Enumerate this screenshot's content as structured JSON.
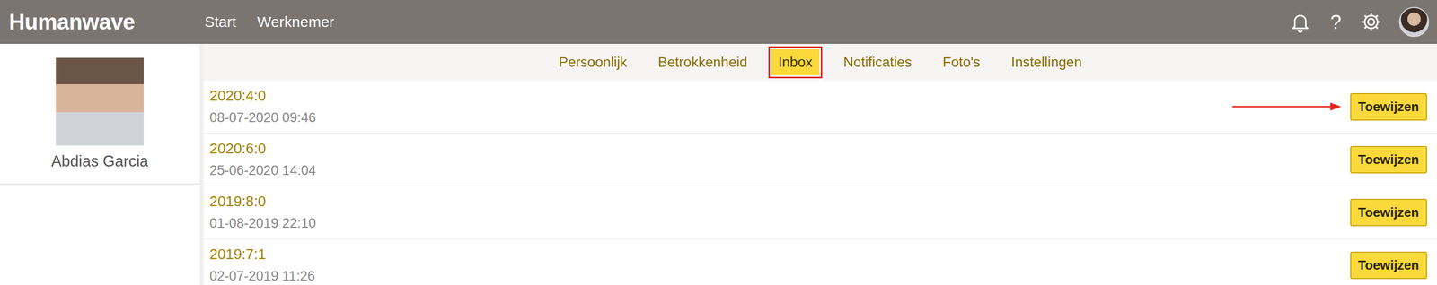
{
  "header": {
    "logo": "Humanwave",
    "nav": [
      {
        "label": "Start"
      },
      {
        "label": "Werknemer"
      }
    ],
    "help": "?"
  },
  "profile": {
    "name": "Abdias Garcia"
  },
  "tabs": [
    {
      "label": "Persoonlijk",
      "selected": false,
      "outlined": false
    },
    {
      "label": "Betrokkenheid",
      "selected": false,
      "outlined": false
    },
    {
      "label": "Inbox",
      "selected": true,
      "outlined": true
    },
    {
      "label": "Notificaties",
      "selected": false,
      "outlined": false
    },
    {
      "label": "Foto's",
      "selected": false,
      "outlined": false
    },
    {
      "label": "Instellingen",
      "selected": false,
      "outlined": false
    }
  ],
  "inbox": [
    {
      "title": "2020:4:0",
      "date": "08-07-2020 09:46",
      "button": "Toewijzen",
      "pointed": true
    },
    {
      "title": "2020:6:0",
      "date": "25-06-2020 14:04",
      "button": "Toewijzen",
      "pointed": false
    },
    {
      "title": "2019:8:0",
      "date": "01-08-2019 22:10",
      "button": "Toewijzen",
      "pointed": false
    },
    {
      "title": "2019:7:1",
      "date": "02-07-2019 11:26",
      "button": "Toewijzen",
      "pointed": false
    }
  ]
}
